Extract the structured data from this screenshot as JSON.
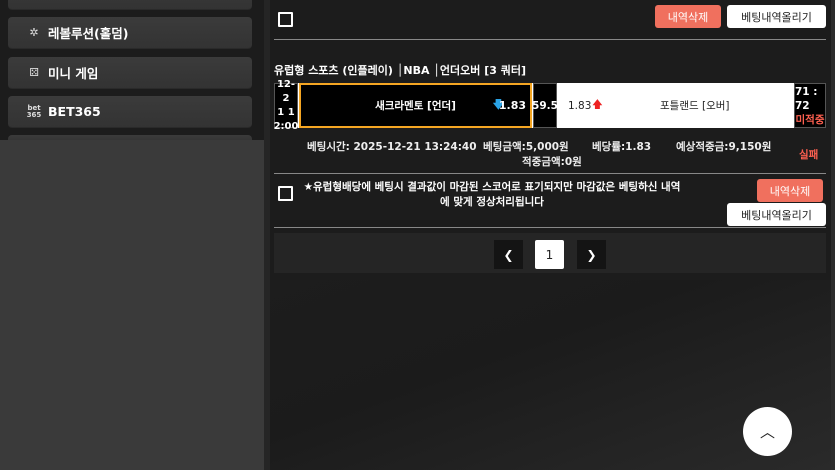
{
  "sidebar": {
    "items": [
      {
        "label": "레볼루션(홀덤)",
        "icon": "chip-icon"
      },
      {
        "label": "미니 게임",
        "icon": "dice-icon"
      },
      {
        "label": "BET365",
        "icon": "bet365-logo-icon",
        "logo_text": "bet\n365"
      }
    ]
  },
  "top_actions": {
    "delete_label": "내역삭제",
    "upload_label": "베팅내역올리기"
  },
  "bet": {
    "title": "유럽형 스포츠 (인플레이) │NBA │언더오버 [3 쿼터]",
    "date": [
      "12-2",
      "1 1",
      "2:00"
    ],
    "home_team": "새크라멘토 [언더]",
    "home_odds": "1.83",
    "home_arrow": "down",
    "mid_value": "59.5",
    "away_odds": "1.83",
    "away_arrow": "up",
    "away_team": "포틀랜드 [오버]",
    "score": "71 : 72",
    "match_status": "미적중",
    "bet_time": "베팅시간: 2025-12-21 13:24:40",
    "bet_amount": "베팅금액:5,000원",
    "bet_odds": "베당률:1.83",
    "expected_win": "예상적중금:9,150원",
    "win_amount": "적중금액:0원",
    "result": "실패"
  },
  "notice": {
    "text": "★유럽형배당에 베팅시 결과값이 마감된 스코어로 표기되지만 마감값은 베팅하신 내역에 맞게 정상처리됩니다",
    "delete_label": "내역삭제",
    "upload_label": "베팅내역올리기"
  },
  "pagination": {
    "current": "1"
  },
  "colors": {
    "accent_red": "#f0705e",
    "highlight_orange": "#f5a623",
    "status_red": "#ff6050"
  }
}
